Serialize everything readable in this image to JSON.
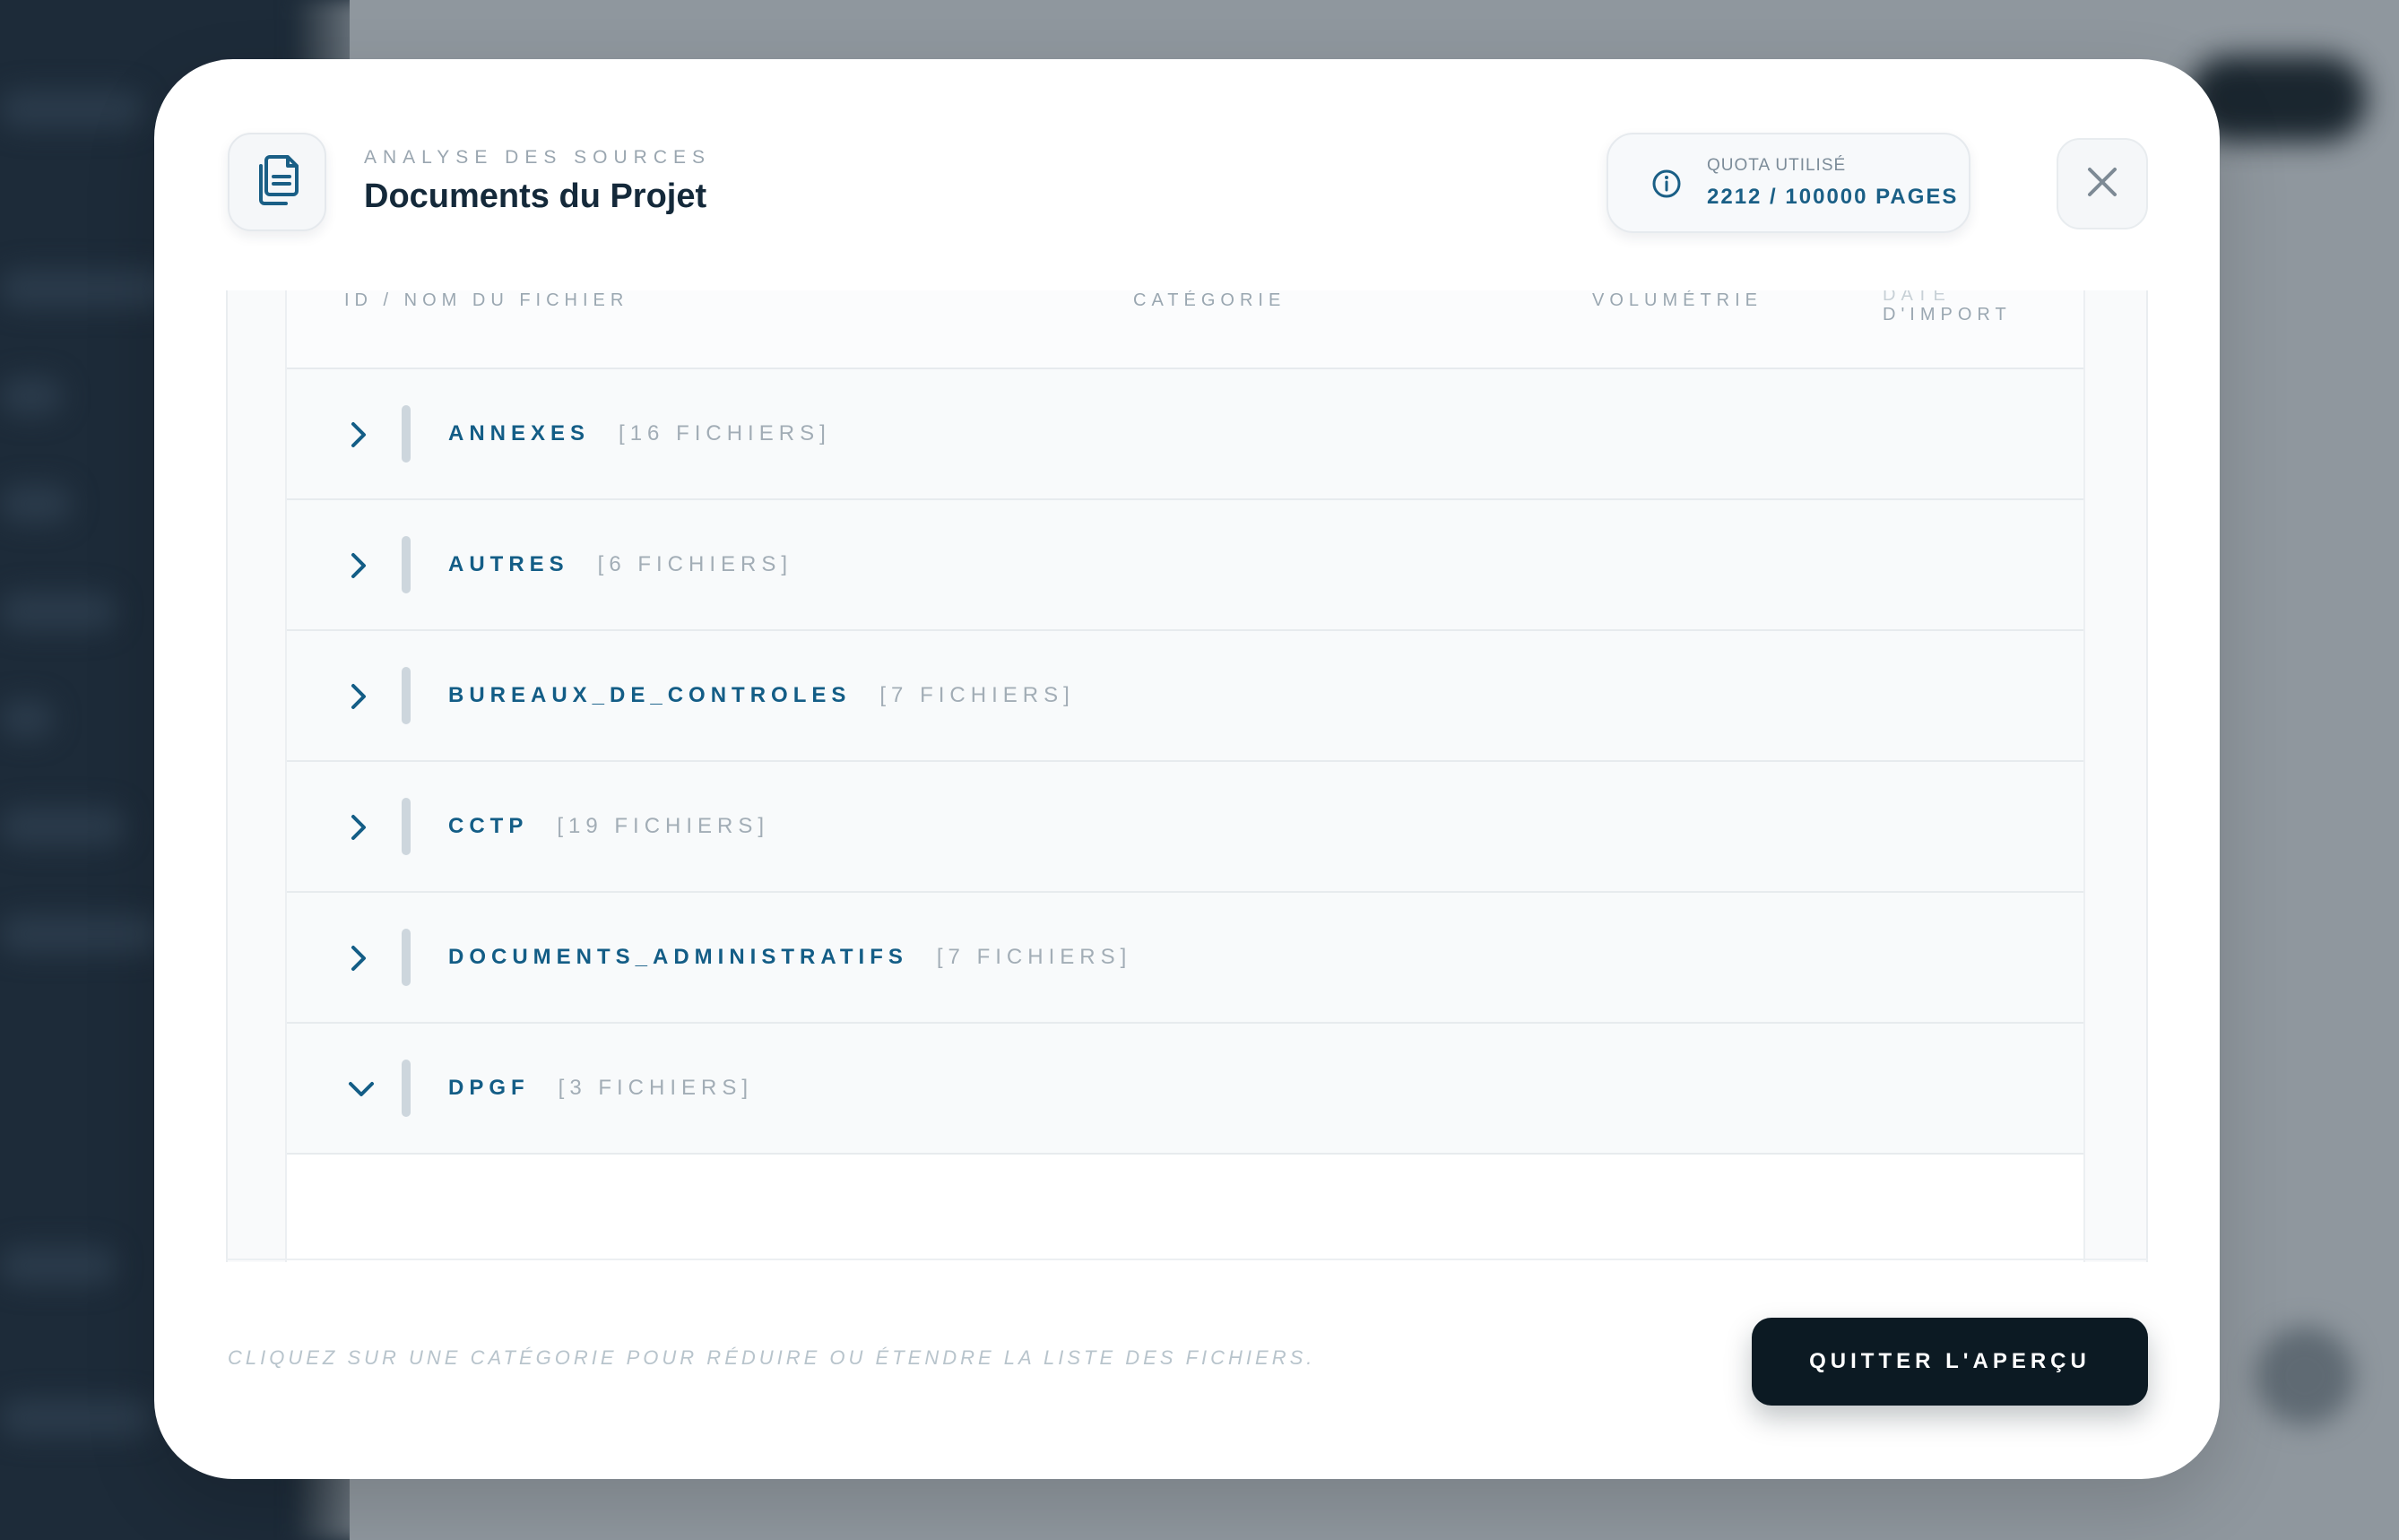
{
  "header": {
    "subtitle": "ANALYSE DES SOURCES",
    "title": "Documents du Projet",
    "icon": "documents-icon"
  },
  "quota": {
    "label": "QUOTA UTILISÉ",
    "value": "2212 / 100000 PAGES",
    "icon": "info-icon"
  },
  "close": {
    "icon": "close-icon"
  },
  "table": {
    "columns": [
      "ID / NOM DU FICHIER",
      "CATÉGORIE",
      "VOLUMÉTRIE",
      "D'IMPORT"
    ],
    "column_date_partial_top": "DATE",
    "rows": [
      {
        "name": "ANNEXES",
        "count": "[16 FICHIERS]",
        "expanded": false
      },
      {
        "name": "AUTRES",
        "count": "[6 FICHIERS]",
        "expanded": false
      },
      {
        "name": "BUREAUX_DE_CONTROLES",
        "count": "[7 FICHIERS]",
        "expanded": false
      },
      {
        "name": "CCTP",
        "count": "[19 FICHIERS]",
        "expanded": false
      },
      {
        "name": "DOCUMENTS_ADMINISTRATIFS",
        "count": "[7 FICHIERS]",
        "expanded": false
      },
      {
        "name": "DPGF",
        "count": "[3 FICHIERS]",
        "expanded": true
      }
    ]
  },
  "footer": {
    "hint": "CLIQUEZ SUR UNE CATÉGORIE POUR RÉDUIRE OU ÉTENDRE LA LISTE DES FICHIERS.",
    "quit_label": "QUITTER L'APERÇU"
  },
  "colors": {
    "accent": "#135d86",
    "primary_button": "#0c1a23",
    "title": "#14293a"
  }
}
